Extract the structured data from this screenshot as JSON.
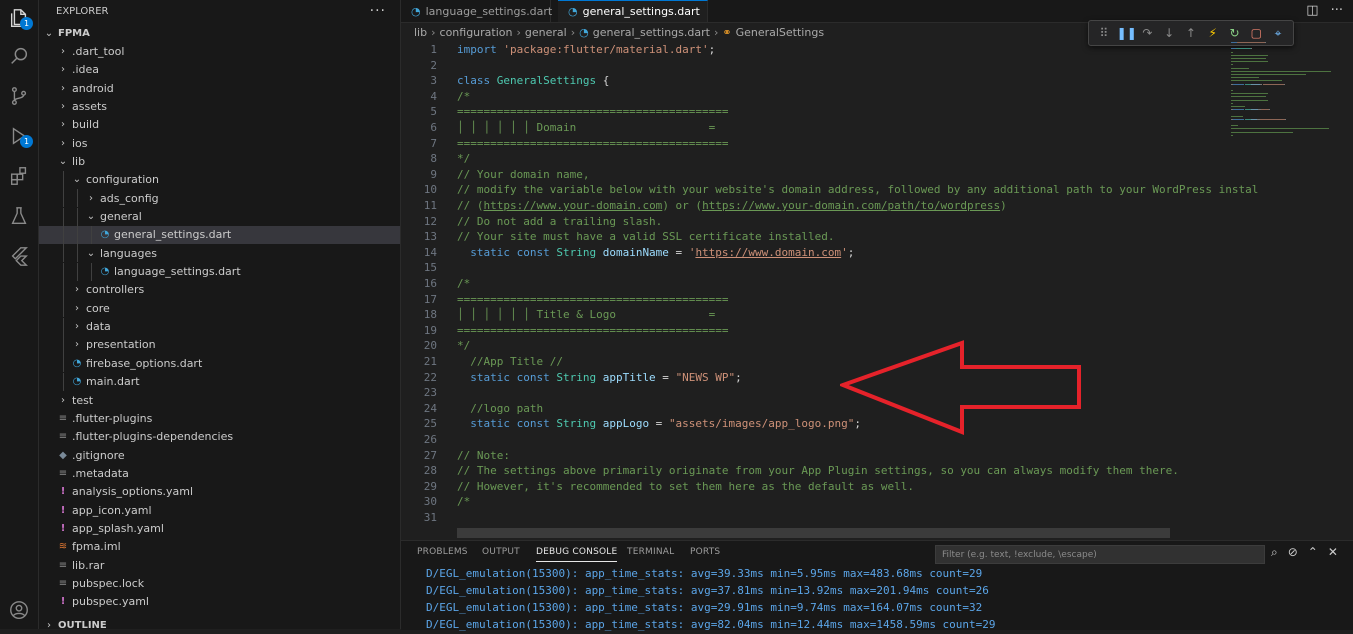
{
  "sidebar": {
    "title": "EXPLORER",
    "more": "···",
    "rows": [
      {
        "label": "FPMA",
        "depth": 0,
        "chev": "v",
        "icon": "",
        "bold": true
      },
      {
        "label": ".dart_tool",
        "depth": 1,
        "chev": ">",
        "icon": ""
      },
      {
        "label": ".idea",
        "depth": 1,
        "chev": ">",
        "icon": ""
      },
      {
        "label": "android",
        "depth": 1,
        "chev": ">",
        "icon": ""
      },
      {
        "label": "assets",
        "depth": 1,
        "chev": ">",
        "icon": ""
      },
      {
        "label": "build",
        "depth": 1,
        "chev": ">",
        "icon": ""
      },
      {
        "label": "ios",
        "depth": 1,
        "chev": ">",
        "icon": ""
      },
      {
        "label": "lib",
        "depth": 1,
        "chev": "v",
        "icon": ""
      },
      {
        "label": "configuration",
        "depth": 2,
        "chev": "v",
        "icon": ""
      },
      {
        "label": "ads_config",
        "depth": 3,
        "chev": ">",
        "icon": ""
      },
      {
        "label": "general",
        "depth": 3,
        "chev": "v",
        "icon": ""
      },
      {
        "label": "general_settings.dart",
        "depth": 4,
        "chev": "",
        "icon": "dart",
        "selected": true
      },
      {
        "label": "languages",
        "depth": 3,
        "chev": "v",
        "icon": ""
      },
      {
        "label": "language_settings.dart",
        "depth": 4,
        "chev": "",
        "icon": "dart"
      },
      {
        "label": "controllers",
        "depth": 2,
        "chev": ">",
        "icon": ""
      },
      {
        "label": "core",
        "depth": 2,
        "chev": ">",
        "icon": ""
      },
      {
        "label": "data",
        "depth": 2,
        "chev": ">",
        "icon": ""
      },
      {
        "label": "presentation",
        "depth": 2,
        "chev": ">",
        "icon": ""
      },
      {
        "label": "firebase_options.dart",
        "depth": 2,
        "chev": "",
        "icon": "dart"
      },
      {
        "label": "main.dart",
        "depth": 2,
        "chev": "",
        "icon": "dart"
      },
      {
        "label": "test",
        "depth": 1,
        "chev": ">",
        "icon": ""
      },
      {
        "label": ".flutter-plugins",
        "depth": 1,
        "chev": "",
        "icon": "gen"
      },
      {
        "label": ".flutter-plugins-dependencies",
        "depth": 1,
        "chev": "",
        "icon": "gen"
      },
      {
        "label": ".gitignore",
        "depth": 1,
        "chev": "",
        "icon": "git"
      },
      {
        "label": ".metadata",
        "depth": 1,
        "chev": "",
        "icon": "gen"
      },
      {
        "label": "analysis_options.yaml",
        "depth": 1,
        "chev": "",
        "icon": "yaml"
      },
      {
        "label": "app_icon.yaml",
        "depth": 1,
        "chev": "",
        "icon": "yaml"
      },
      {
        "label": "app_splash.yaml",
        "depth": 1,
        "chev": "",
        "icon": "yaml"
      },
      {
        "label": "fpma.iml",
        "depth": 1,
        "chev": "",
        "icon": "xml"
      },
      {
        "label": "lib.rar",
        "depth": 1,
        "chev": "",
        "icon": "gen"
      },
      {
        "label": "pubspec.lock",
        "depth": 1,
        "chev": "",
        "icon": "gen"
      },
      {
        "label": "pubspec.yaml",
        "depth": 1,
        "chev": "",
        "icon": "yaml"
      },
      {
        "label": "OUTLINE",
        "depth": 0,
        "chev": ">",
        "icon": "",
        "bold": true
      }
    ]
  },
  "activity": {
    "explorer_badge": "1",
    "debug_badge": "1"
  },
  "tabs": [
    {
      "label": "language_settings.dart",
      "active": false
    },
    {
      "label": "general_settings.dart",
      "active": true,
      "modified": true
    }
  ],
  "breadcrumb": [
    "lib",
    "configuration",
    "general",
    "general_settings.dart",
    "GeneralSettings"
  ],
  "code": [
    {
      "n": "1",
      "parts": [
        [
          "kw",
          "import "
        ],
        [
          "str",
          "'package:flutter/material.dart'"
        ],
        [
          "plain",
          ";"
        ]
      ]
    },
    {
      "n": "2",
      "parts": []
    },
    {
      "n": "3",
      "parts": [
        [
          "kw",
          "class "
        ],
        [
          "cls",
          "GeneralSettings "
        ],
        [
          "plain",
          "{"
        ]
      ]
    },
    {
      "n": "4",
      "parts": [
        [
          "cm",
          "/*"
        ]
      ]
    },
    {
      "n": "5",
      "parts": [
        [
          "cm",
          "========================================="
        ]
      ]
    },
    {
      "n": "6",
      "parts": [
        [
          "cm",
          "│ │ │ │ │ │ Domain                    ="
        ]
      ]
    },
    {
      "n": "7",
      "parts": [
        [
          "cm",
          "========================================="
        ]
      ]
    },
    {
      "n": "8",
      "parts": [
        [
          "cm",
          "*/"
        ]
      ]
    },
    {
      "n": "9",
      "parts": [
        [
          "cm",
          "// Your domain name,"
        ]
      ]
    },
    {
      "n": "10",
      "parts": [
        [
          "cm",
          "// modify the variable below with your website's domain address, followed by any additional path to your WordPress instal"
        ]
      ]
    },
    {
      "n": "11",
      "parts": [
        [
          "cm",
          "// ("
        ],
        [
          "cm link",
          "https://www.your-domain.com"
        ],
        [
          "cm",
          ") or ("
        ],
        [
          "cm link",
          "https://www.your-domain.com/path/to/wordpress"
        ],
        [
          "cm",
          ")"
        ]
      ]
    },
    {
      "n": "12",
      "parts": [
        [
          "cm",
          "// Do not add a trailing slash."
        ]
      ]
    },
    {
      "n": "13",
      "parts": [
        [
          "cm",
          "// Your site must have a valid SSL certificate installed."
        ]
      ]
    },
    {
      "n": "14",
      "parts": [
        [
          "plain",
          "  "
        ],
        [
          "kw",
          "static const "
        ],
        [
          "cls",
          "String "
        ],
        [
          "var",
          "domainName"
        ],
        [
          "plain",
          " = "
        ],
        [
          "str",
          "'"
        ],
        [
          "str link",
          "https://www.domain.com"
        ],
        [
          "str",
          "'"
        ],
        [
          "plain",
          ";"
        ]
      ]
    },
    {
      "n": "15",
      "parts": []
    },
    {
      "n": "16",
      "parts": [
        [
          "cm",
          "/*"
        ]
      ]
    },
    {
      "n": "17",
      "parts": [
        [
          "cm",
          "========================================="
        ]
      ]
    },
    {
      "n": "18",
      "parts": [
        [
          "cm",
          "│ │ │ │ │ │ Title & Logo              ="
        ]
      ]
    },
    {
      "n": "19",
      "parts": [
        [
          "cm",
          "========================================="
        ]
      ]
    },
    {
      "n": "20",
      "parts": [
        [
          "cm",
          "*/"
        ]
      ]
    },
    {
      "n": "21",
      "parts": [
        [
          "cm",
          "  //App Title //"
        ]
      ]
    },
    {
      "n": "22",
      "parts": [
        [
          "plain",
          "  "
        ],
        [
          "kw",
          "static const "
        ],
        [
          "cls",
          "String "
        ],
        [
          "var",
          "appTitle"
        ],
        [
          "plain",
          " = "
        ],
        [
          "str",
          "\"NEWS WP\""
        ],
        [
          "plain",
          ";"
        ]
      ]
    },
    {
      "n": "23",
      "parts": []
    },
    {
      "n": "24",
      "parts": [
        [
          "cm",
          "  //logo path"
        ]
      ]
    },
    {
      "n": "25",
      "parts": [
        [
          "plain",
          "  "
        ],
        [
          "kw",
          "static const "
        ],
        [
          "cls",
          "String "
        ],
        [
          "var",
          "appLogo"
        ],
        [
          "plain",
          " = "
        ],
        [
          "str",
          "\"assets/images/app_logo.png\""
        ],
        [
          "plain",
          ";"
        ]
      ]
    },
    {
      "n": "26",
      "parts": []
    },
    {
      "n": "27",
      "parts": [
        [
          "cm",
          "// Note:"
        ]
      ]
    },
    {
      "n": "28",
      "parts": [
        [
          "cm",
          "// The settings above primarily originate from your App Plugin settings, so you can always modify them there."
        ]
      ]
    },
    {
      "n": "29",
      "parts": [
        [
          "cm",
          "// However, it's recommended to set them here as the default as well."
        ]
      ]
    },
    {
      "n": "30",
      "parts": [
        [
          "cm",
          "/*"
        ]
      ]
    },
    {
      "n": "31",
      "parts": []
    }
  ],
  "panel": {
    "tabs": [
      "PROBLEMS",
      "OUTPUT",
      "DEBUG CONSOLE",
      "TERMINAL",
      "PORTS"
    ],
    "active_tab": "DEBUG CONSOLE",
    "filter_placeholder": "Filter (e.g. text, !exclude, \\escape)",
    "logs": [
      "D/EGL_emulation(15300): app_time_stats: avg=39.33ms min=5.95ms max=483.68ms count=29",
      "D/EGL_emulation(15300): app_time_stats: avg=37.81ms min=13.92ms max=201.94ms count=26",
      "D/EGL_emulation(15300): app_time_stats: avg=29.91ms min=9.74ms max=164.07ms count=32",
      "D/EGL_emulation(15300): app_time_stats: avg=82.04ms min=12.44ms max=1458.59ms count=29"
    ]
  },
  "colors": {
    "accent": "#0078d4",
    "arrow": "#e5222a",
    "comment": "#6a9955",
    "keyword": "#569cd6",
    "string": "#ce9178"
  }
}
